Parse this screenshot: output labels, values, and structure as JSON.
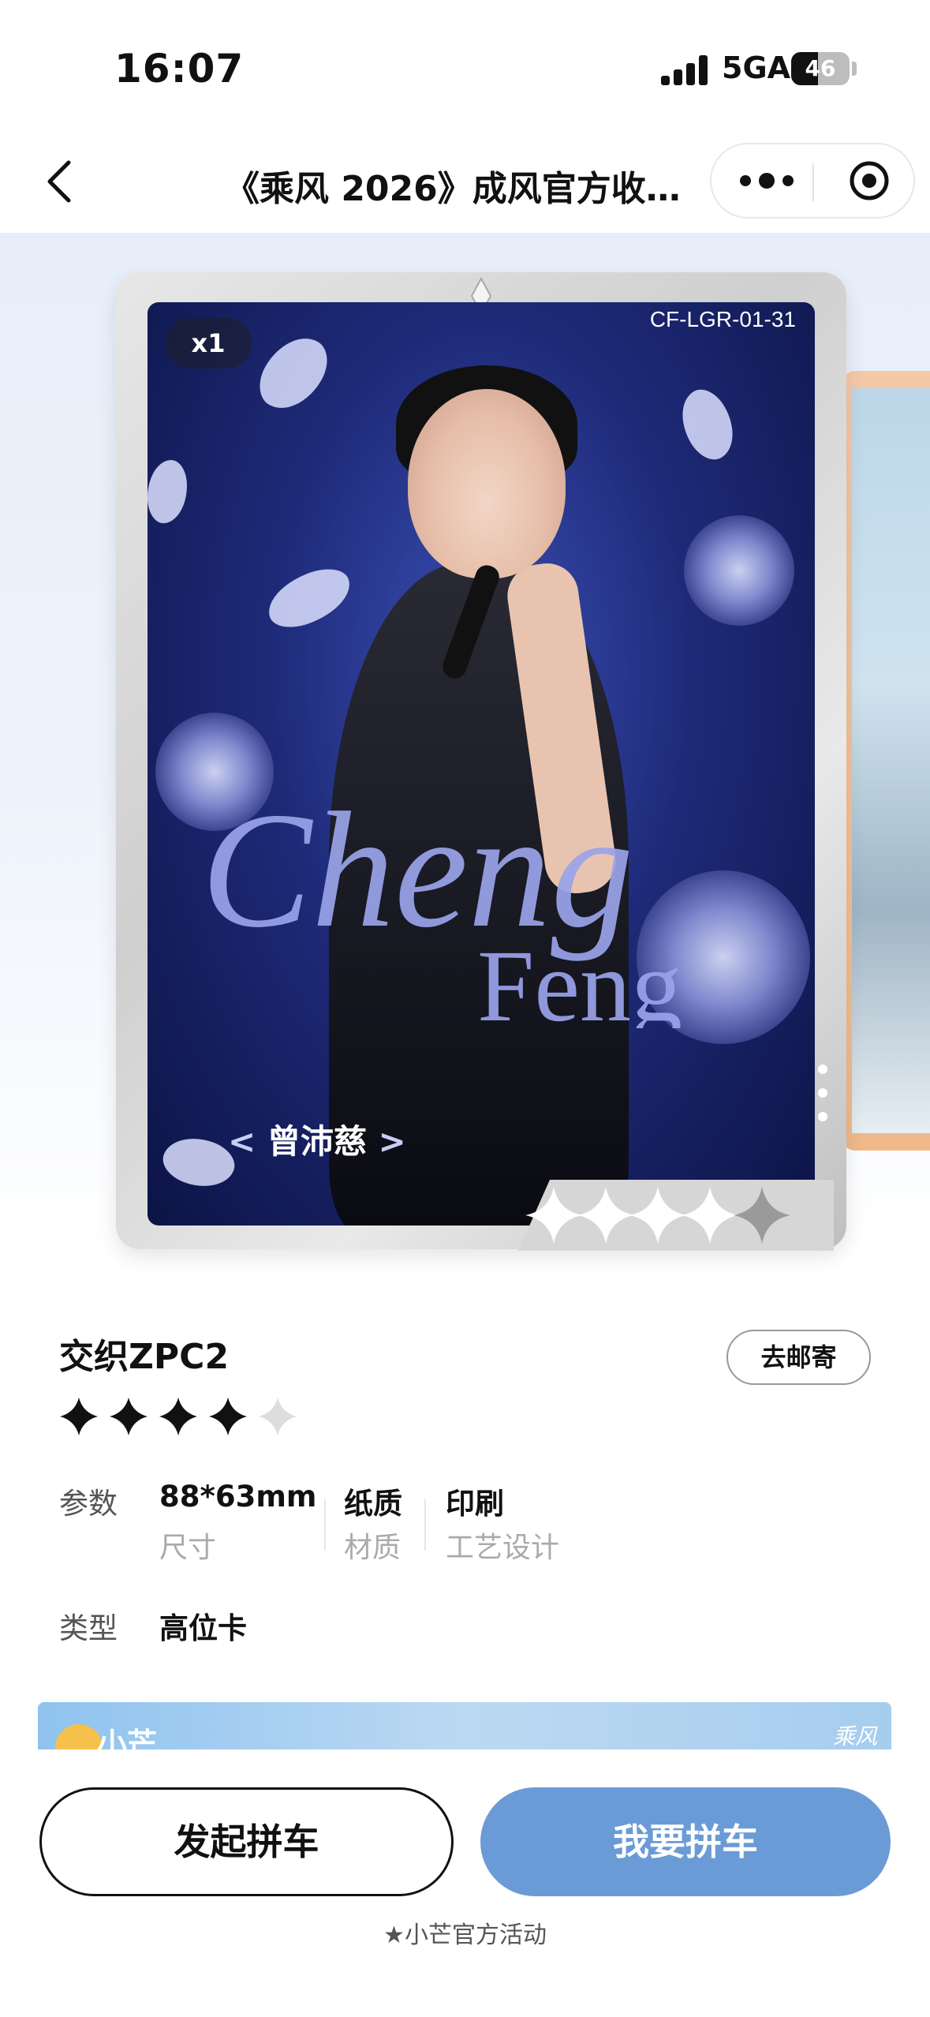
{
  "status_bar": {
    "time": "16:07",
    "network": "5GA",
    "battery": "46",
    "battery_level": 0.46
  },
  "nav": {
    "title": "《乘风 2026》成风官方收…"
  },
  "card": {
    "serial": "CF-LGR-01-31",
    "quantity": "x1",
    "artist_name": "曾沛慈",
    "name_left": "<",
    "name_right": ">",
    "watermark_word_1": "Cheng",
    "watermark_word_2": "Feng"
  },
  "product": {
    "title": "交织ZPC2",
    "mail_button": "去邮寄",
    "rating": 4,
    "rating_max": 5,
    "specs": {
      "label": "参数",
      "size_value": "88*63mm",
      "size_label": "尺寸",
      "material_value": "纸质",
      "material_label": "材质",
      "print_value": "印刷",
      "print_label": "工艺设计"
    },
    "type_label": "类型",
    "type_value": "高位卡"
  },
  "banner": {
    "logo_text": "小芒",
    "brand_text": "乘风"
  },
  "actions": {
    "start_button": "发起拼车",
    "join_button": "我要拼车",
    "footer_note": "★小芒官方活动"
  },
  "colors": {
    "primary_button": "#6b9bd6",
    "hero_bg": "#e7eef9",
    "card_frame": "#d6d6d6"
  }
}
